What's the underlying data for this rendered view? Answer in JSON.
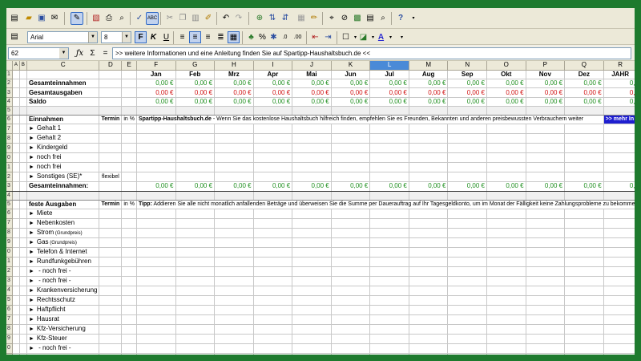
{
  "toolbar": {
    "font_name": "Arial",
    "font_size": "8"
  },
  "formula_bar": {
    "cell_ref": "62",
    "content": ">> weitere Informationen und eine Anleitung finden Sie auf Spartipp-Haushaltsbuch.de <<"
  },
  "columns": [
    "A",
    "B",
    "C",
    "D",
    "E",
    "F",
    "G",
    "H",
    "I",
    "J",
    "K",
    "L",
    "M",
    "N",
    "O",
    "P",
    "Q",
    "R"
  ],
  "months": [
    "Jan",
    "Feb",
    "Mrz",
    "Apr",
    "Mai",
    "Jun",
    "Jul",
    "Aug",
    "Sep",
    "Okt",
    "Nov",
    "Dez",
    "JAHR"
  ],
  "zero": "0,00 €",
  "zero_cut": "0,",
  "summary": {
    "gesamteinnahmen": "Gesamteinnahmen",
    "gesamtausgaben": "Gesamtausgaben",
    "saldo": "Saldo"
  },
  "einnahmen": {
    "header": "Einnahmen",
    "termin": "Termin",
    "in_pct": "in %",
    "note_bold": "Spartipp-Haushaltsbuch.de",
    "note": " - Wenn Sie das kostenlose Haushaltsbuch hilfreich finden, empfehlen Sie es Freunden, Bekannten und anderen preisbewussten Verbrauchern weiter",
    "mehr": ">> mehr In",
    "items": [
      "Gehalt 1",
      "Gehalt 2",
      "Kindergeld",
      "noch frei",
      "noch frei",
      "Sonstiges (SE)*"
    ],
    "flexibel": "flexibel",
    "total": "Gesamteinnahmen:"
  },
  "ausgaben": {
    "header": "feste Ausgaben",
    "termin": "Termin",
    "in_pct": "in %",
    "note_bold": "Tipp:",
    "note": " Addieren Sie alle nicht monatlich anfallenden Beträge und überweisen Sie die Summe per Dauerauftrag auf Ihr Tagesgeldkonto, um im Monat der Fälligkeit keine Zahlungsprobleme zu bekomme",
    "items": [
      {
        "label": "Miete"
      },
      {
        "label": "Nebenkosten"
      },
      {
        "label": "Strom",
        "sub": "(Grundpreis)"
      },
      {
        "label": "Gas",
        "sub": "(Grundpreis)"
      },
      {
        "label": "Telefon & Internet"
      },
      {
        "label": "Rundfunkgebühren"
      },
      {
        "label": " - noch frei -"
      },
      {
        "label": " - noch frei -"
      },
      {
        "label": "Krankenversicherung"
      },
      {
        "label": "Rechtsschutz"
      },
      {
        "label": "Haftpflicht"
      },
      {
        "label": "Hausrat"
      },
      {
        "label": "Kfz-Versicherung"
      },
      {
        "label": "Kfz-Steuer"
      },
      {
        "label": " - noch frei -"
      },
      {
        "label": " - noch frei -"
      },
      {
        "label": "Abo 1"
      }
    ]
  },
  "row_numbers": [
    "1",
    "2",
    "3",
    "4",
    "5",
    "6",
    "7",
    "8",
    "9",
    "0",
    "1",
    "2",
    "3",
    "4",
    "5",
    "6",
    "7",
    "8",
    "9",
    "0",
    "1",
    "2",
    "3",
    "4",
    "5",
    "6",
    "7",
    "8",
    "9",
    "0",
    "1",
    "2"
  ]
}
